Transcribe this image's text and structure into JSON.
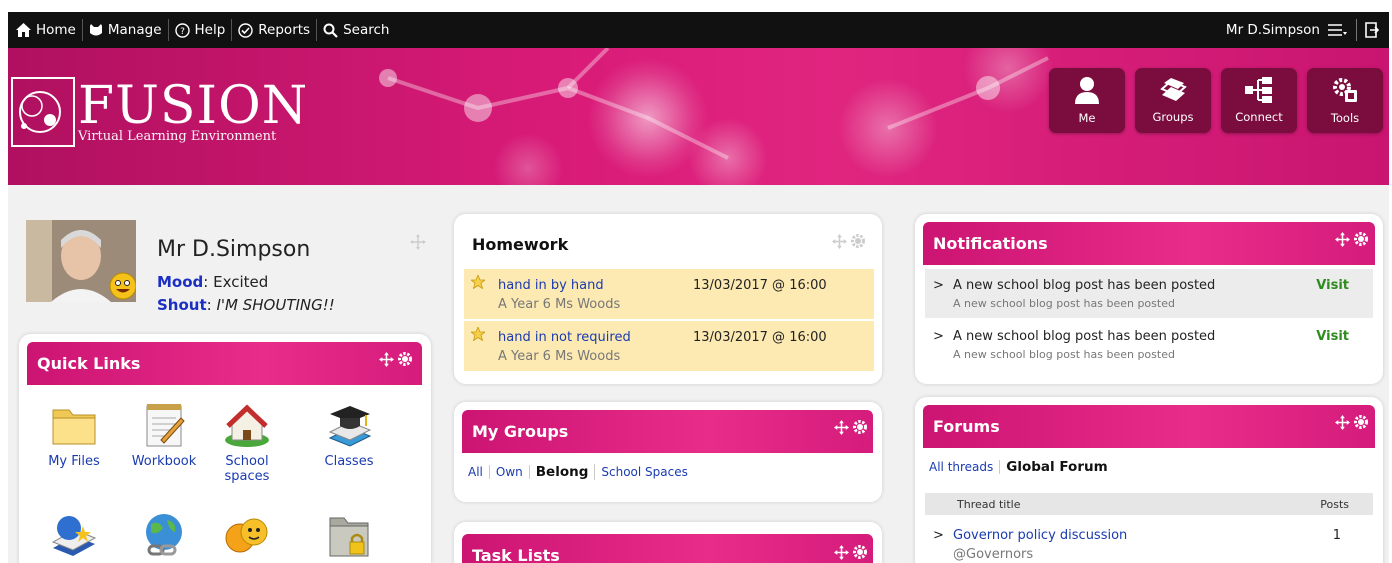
{
  "topbar": {
    "home": "Home",
    "manage": "Manage",
    "help": "Help",
    "reports": "Reports",
    "search": "Search",
    "user": "Mr D.Simpson"
  },
  "banner": {
    "logo_title": "FUSION",
    "logo_subtitle": "Virtual Learning Environment",
    "tiles": [
      {
        "label": "Me",
        "icon": "user-icon"
      },
      {
        "label": "Groups",
        "icon": "books-icon"
      },
      {
        "label": "Connect",
        "icon": "network-icon"
      },
      {
        "label": "Tools",
        "icon": "gear-tools-icon"
      }
    ]
  },
  "profile": {
    "name": "Mr D.Simpson",
    "mood_label": "Mood",
    "mood_value": "Excited",
    "shout_label": "Shout",
    "shout_value": "I'M SHOUTING!!"
  },
  "quick_links": {
    "title": "Quick Links",
    "items": [
      {
        "label": "My Files",
        "icon": "folder-icon"
      },
      {
        "label": "Workbook",
        "icon": "notepad-icon"
      },
      {
        "label": "School spaces",
        "icon": "school-house-icon"
      },
      {
        "label": "Classes",
        "icon": "graduation-cap-icon"
      },
      {
        "label": "",
        "icon": "star-book-icon"
      },
      {
        "label": "",
        "icon": "globe-link-icon"
      },
      {
        "label": "",
        "icon": "emoji-faces-icon"
      },
      {
        "label": "",
        "icon": "locked-folder-icon"
      }
    ]
  },
  "homework": {
    "title": "Homework",
    "items": [
      {
        "title": "hand in by hand",
        "sub": "A Year 6 Ms Woods",
        "due": "13/03/2017 @ 16:00"
      },
      {
        "title": "hand in not required",
        "sub": "A Year 6 Ms Woods",
        "due": "13/03/2017 @ 16:00"
      }
    ]
  },
  "my_groups": {
    "title": "My Groups",
    "tabs": [
      "All",
      "Own",
      "Belong",
      "School Spaces"
    ],
    "active_tab": "Belong"
  },
  "task_lists": {
    "title": "Task Lists"
  },
  "notifications": {
    "title": "Notifications",
    "items": [
      {
        "title": "A new school blog post has been posted",
        "sub": "A new school blog post has been posted",
        "action": "Visit"
      },
      {
        "title": "A new school blog post has been posted",
        "sub": "A new school blog post has been posted",
        "action": "Visit"
      }
    ]
  },
  "forums": {
    "title": "Forums",
    "tabs": [
      "All threads",
      "Global Forum"
    ],
    "active_tab": "Global Forum",
    "col_thread": "Thread title",
    "col_posts": "Posts",
    "rows": [
      {
        "title": "Governor policy discussion",
        "sub": "@Governors",
        "posts": "1"
      }
    ]
  },
  "colors": {
    "accent_pink": "#e0257f",
    "tile_bg": "#7a0d3d",
    "link_blue": "#1a3bb0",
    "visit_green": "#2e8b1e",
    "homework_bg": "#fdeab3"
  }
}
